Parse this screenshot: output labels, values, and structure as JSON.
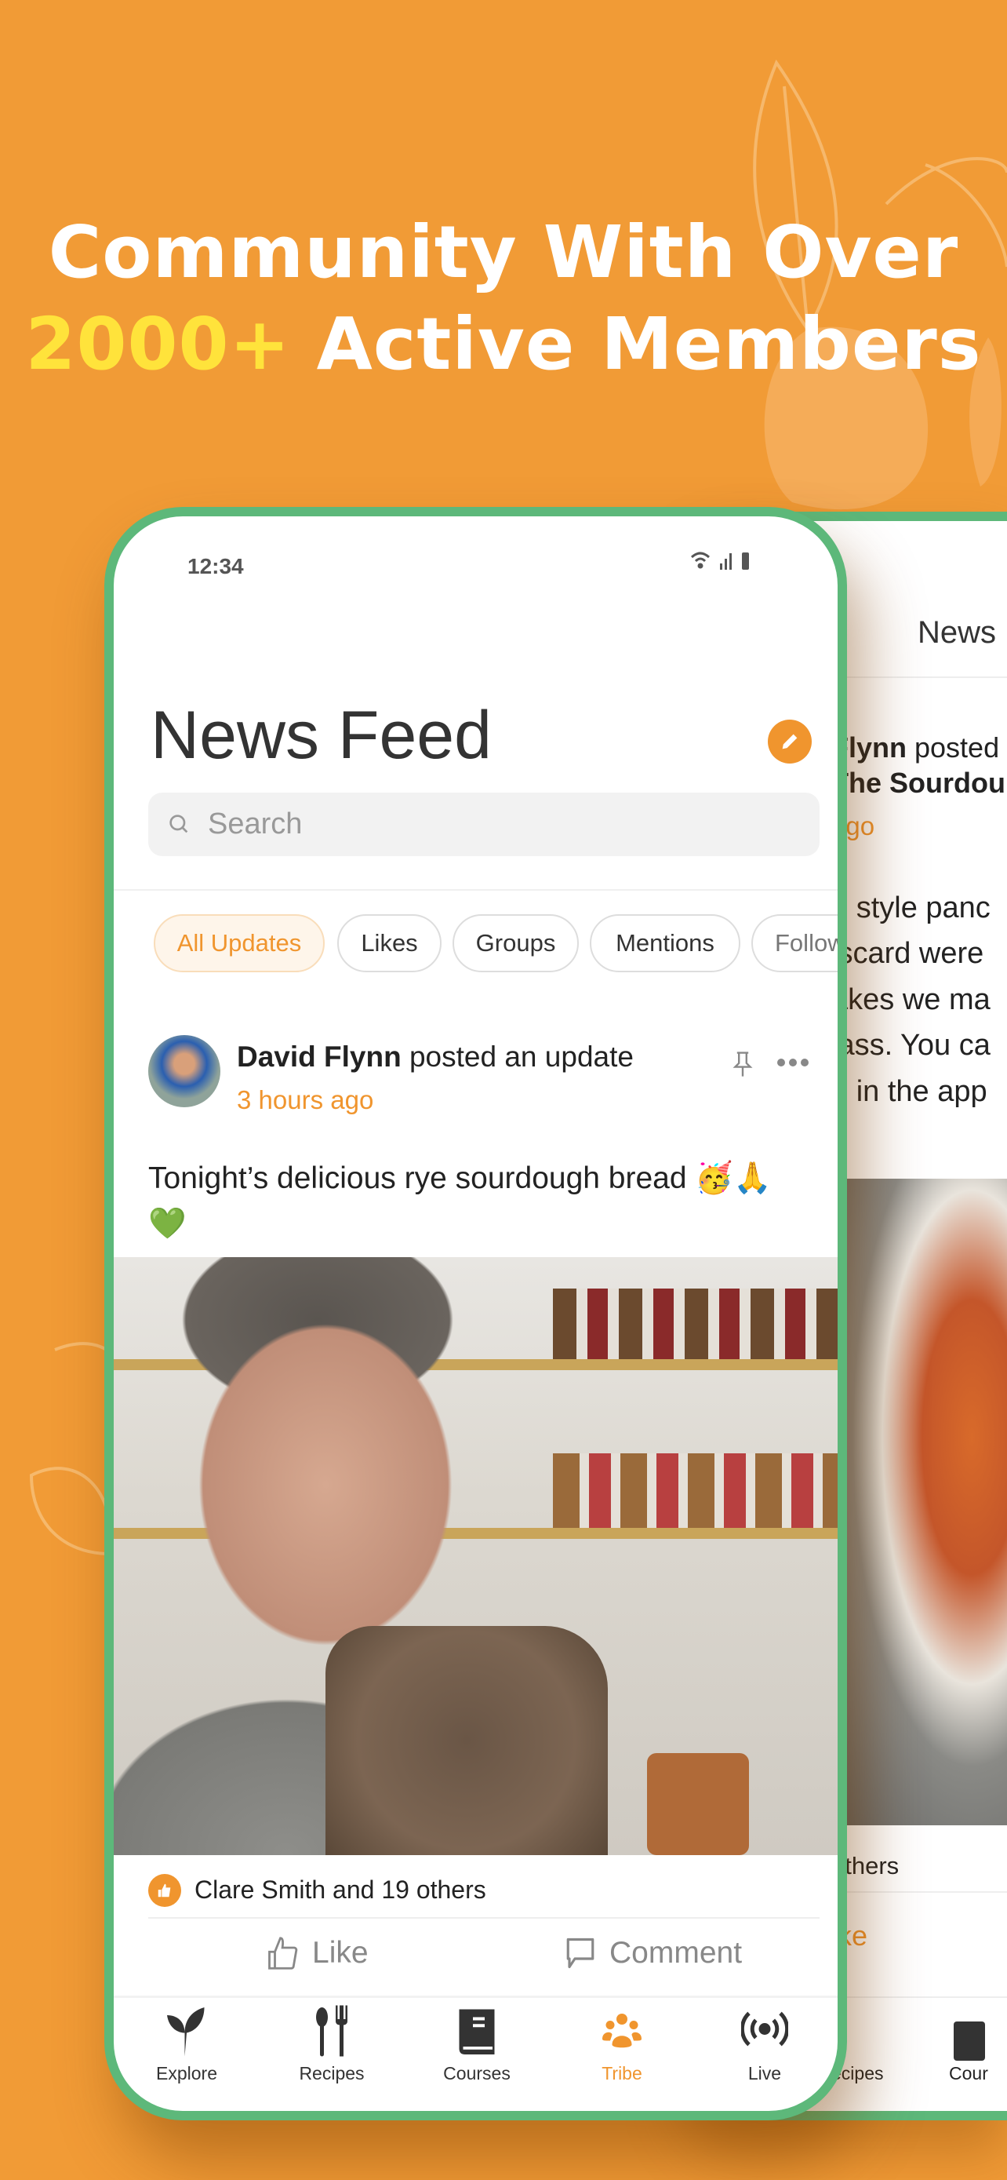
{
  "headline": {
    "line1": "Community With Over",
    "highlight": "2000+",
    "line2_rest": " Active Members"
  },
  "colors": {
    "background": "#F19B36",
    "accent": "#F0952E",
    "highlight": "#FFE33B",
    "frame": "#5DB87A"
  },
  "front": {
    "status": {
      "time": "12:34",
      "icons": [
        "wifi-icon",
        "signal-icon",
        "battery-icon"
      ]
    },
    "title": "News Feed",
    "edit_icon": "pencil-icon",
    "search": {
      "placeholder": "Search",
      "icon": "search-icon"
    },
    "chips": [
      {
        "label": "All Updates",
        "active": true
      },
      {
        "label": "Likes"
      },
      {
        "label": "Groups"
      },
      {
        "label": "Mentions"
      },
      {
        "label": "Follow"
      }
    ],
    "post": {
      "author": "David Flynn",
      "action": " posted an update",
      "time": "3 hours ago",
      "text": "Tonight’s delicious rye sourdough bread 🥳🙏",
      "text2": "💚",
      "likes": "Clare Smith and 19 others",
      "like": "Like",
      "comment": "Comment"
    },
    "nav": [
      {
        "label": "Explore",
        "icon": "sprout-icon"
      },
      {
        "label": "Recipes",
        "icon": "cutlery-icon"
      },
      {
        "label": "Courses",
        "icon": "book-icon"
      },
      {
        "label": "Tribe",
        "icon": "group-icon",
        "active": true
      },
      {
        "label": "Live",
        "icon": "broadcast-icon"
      }
    ]
  },
  "back": {
    "title": "News",
    "author_frag": "Flynn",
    "action_frag": " posted",
    "group_frag": "The Sourdou",
    "time_frag": "ago",
    "lines": [
      "n style panc",
      "iscard were",
      "akes we ma",
      "lass. You ca",
      "o in the app"
    ],
    "likes_frag": "others",
    "like_frag": "ike",
    "nav": [
      "ecipes",
      "Cour"
    ]
  }
}
